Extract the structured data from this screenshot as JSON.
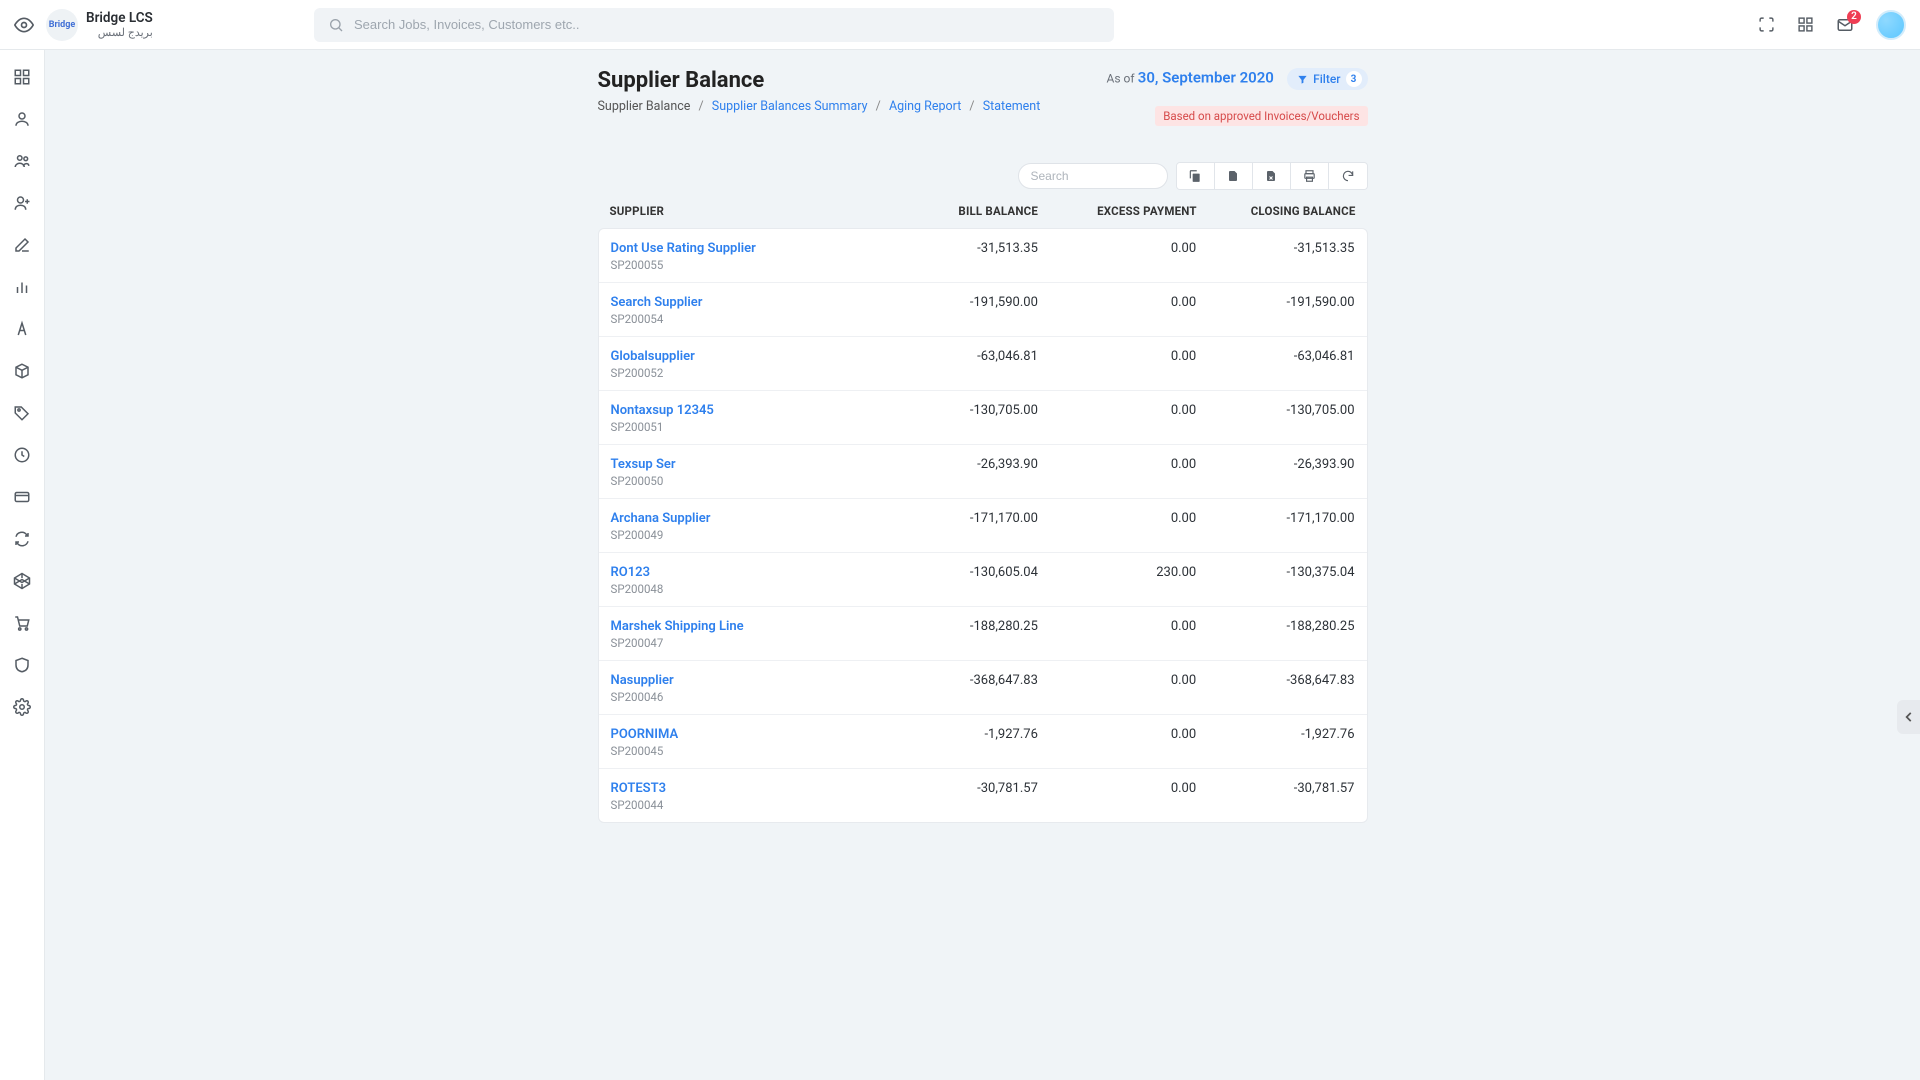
{
  "brand": {
    "name": "Bridge LCS",
    "sub": "بريدج لسس",
    "logo": "Bridge"
  },
  "search": {
    "placeholder": "Search Jobs, Invoices, Customers etc.."
  },
  "notif_count": "2",
  "page": {
    "title": "Supplier Balance",
    "asof_prefix": "As of",
    "asof_date": "30, September 2020",
    "filter_label": "Filter",
    "filter_count": "3",
    "note": "Based on approved Invoices/Vouchers"
  },
  "breadcrumb": {
    "current": "Supplier Balance",
    "links": [
      "Supplier Balances Summary",
      "Aging Report",
      "Statement"
    ]
  },
  "table_search_placeholder": "Search",
  "columns": {
    "c1": "SUPPLIER",
    "c2": "BILL BALANCE",
    "c3": "EXCESS PAYMENT",
    "c4": "CLOSING BALANCE"
  },
  "rows": [
    {
      "name": "Dont Use Rating Supplier",
      "code": "SP200055",
      "bill": "-31,513.35",
      "excess": "0.00",
      "close": "-31,513.35"
    },
    {
      "name": "Search Supplier",
      "code": "SP200054",
      "bill": "-191,590.00",
      "excess": "0.00",
      "close": "-191,590.00"
    },
    {
      "name": "Globalsupplier",
      "code": "SP200052",
      "bill": "-63,046.81",
      "excess": "0.00",
      "close": "-63,046.81"
    },
    {
      "name": "Nontaxsup 12345",
      "code": "SP200051",
      "bill": "-130,705.00",
      "excess": "0.00",
      "close": "-130,705.00"
    },
    {
      "name": "Texsup Ser",
      "code": "SP200050",
      "bill": "-26,393.90",
      "excess": "0.00",
      "close": "-26,393.90"
    },
    {
      "name": "Archana Supplier",
      "code": "SP200049",
      "bill": "-171,170.00",
      "excess": "0.00",
      "close": "-171,170.00"
    },
    {
      "name": "RO123",
      "code": "SP200048",
      "bill": "-130,605.04",
      "excess": "230.00",
      "close": "-130,375.04"
    },
    {
      "name": "Marshek Shipping Line",
      "code": "SP200047",
      "bill": "-188,280.25",
      "excess": "0.00",
      "close": "-188,280.25"
    },
    {
      "name": "Nasupplier",
      "code": "SP200046",
      "bill": "-368,647.83",
      "excess": "0.00",
      "close": "-368,647.83"
    },
    {
      "name": "POORNIMA",
      "code": "SP200045",
      "bill": "-1,927.76",
      "excess": "0.00",
      "close": "-1,927.76"
    },
    {
      "name": "ROTEST3",
      "code": "SP200044",
      "bill": "-30,781.57",
      "excess": "0.00",
      "close": "-30,781.57"
    }
  ]
}
